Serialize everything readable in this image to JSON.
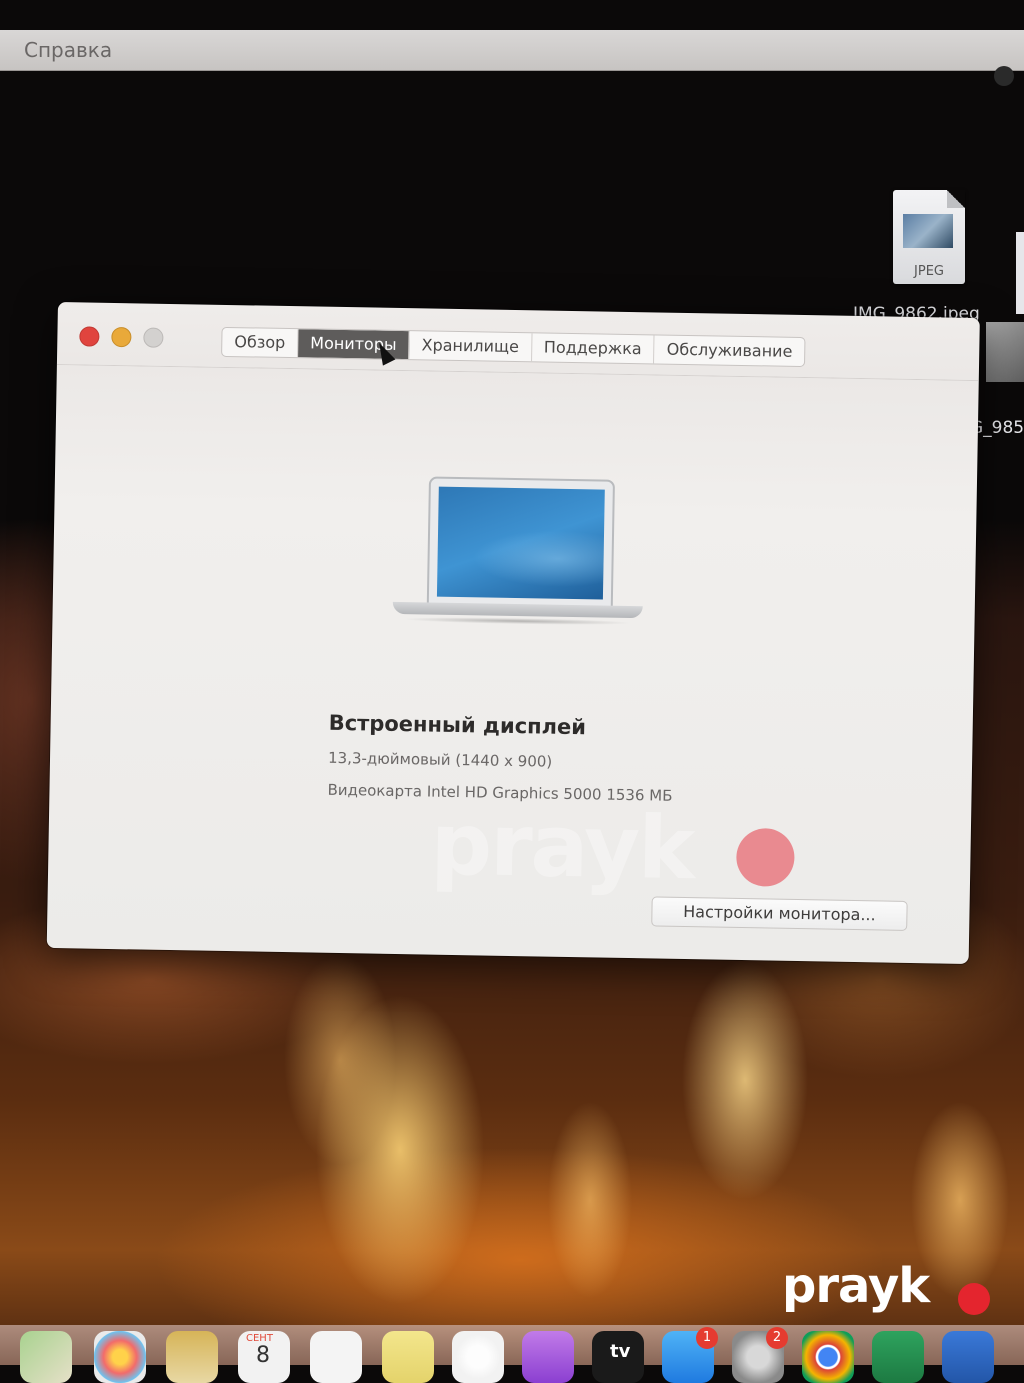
{
  "menubar": {
    "menu_label": "Справка"
  },
  "desktop": {
    "file_icon_ext": "JPEG",
    "file1_name": "IMG_9862.jpeg",
    "file2_name_partial": "G_985"
  },
  "window": {
    "tabs": [
      {
        "label": "Обзор",
        "active": false
      },
      {
        "label": "Мониторы",
        "active": true
      },
      {
        "label": "Хранилище",
        "active": false
      },
      {
        "label": "Поддержка",
        "active": false
      },
      {
        "label": "Обслуживание",
        "active": false
      }
    ],
    "display_title": "Встроенный дисплей",
    "display_size": "13,3-дюймовый (1440 x 900)",
    "display_gpu": "Видеокарта Intel HD Graphics 5000 1536 МБ",
    "button_label": "Настройки монитора..."
  },
  "watermark": {
    "text": "prayk"
  },
  "logo": {
    "text": "prayk"
  },
  "dock": {
    "calendar_month": "СЕНТ",
    "calendar_day": "8",
    "tv_label": "tv",
    "app_store_badge": "1",
    "settings_badge": "2"
  },
  "colors": {
    "traffic_close": "#e0443e",
    "traffic_min": "#e9a93a",
    "active_tab": "#5e5c5b",
    "logo_dot": "#e4252e"
  }
}
